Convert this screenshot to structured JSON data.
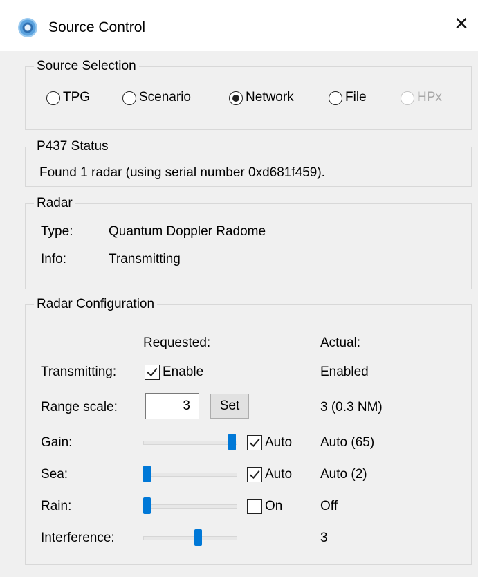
{
  "window": {
    "title": "Source Control",
    "close_glyph": "✕",
    "icon": "radar-app-icon"
  },
  "source_selection": {
    "legend": "Source Selection",
    "options": [
      {
        "label": "TPG",
        "checked": false,
        "enabled": true
      },
      {
        "label": "Scenario",
        "checked": false,
        "enabled": true
      },
      {
        "label": "Network",
        "checked": true,
        "enabled": true
      },
      {
        "label": "File",
        "checked": false,
        "enabled": true
      },
      {
        "label": "HPx",
        "checked": false,
        "enabled": false
      }
    ]
  },
  "p437_status": {
    "legend": "P437 Status",
    "message": "Found 1 radar (using serial number 0xd681f459)."
  },
  "radar": {
    "legend": "Radar",
    "type_label": "Type:",
    "type_value": "Quantum Doppler Radome",
    "info_label": "Info:",
    "info_value": "Transmitting"
  },
  "radar_config": {
    "legend": "Radar Configuration",
    "requested_header": "Requested:",
    "actual_header": "Actual:",
    "transmitting": {
      "label": "Transmitting:",
      "checkbox_label": "Enable",
      "checked": true,
      "actual": "Enabled"
    },
    "range_scale": {
      "label": "Range scale:",
      "value": "3",
      "button": "Set",
      "actual": "3 (0.3 NM)"
    },
    "gain": {
      "label": "Gain:",
      "level": 1.0,
      "checkbox_label": "Auto",
      "checked": true,
      "actual": "Auto (65)"
    },
    "sea": {
      "label": "Sea:",
      "level": 0.0,
      "checkbox_label": "Auto",
      "checked": true,
      "actual": "Auto (2)"
    },
    "rain": {
      "label": "Rain:",
      "level": 0.0,
      "checkbox_label": "On",
      "checked": false,
      "actual": "Off"
    },
    "interference": {
      "label": "Interference:",
      "level": 0.6,
      "actual": "3"
    }
  },
  "colors": {
    "accent": "#0078d7",
    "dialog_bg": "#f0f0f0",
    "group_border": "#d8d8d8",
    "disabled": "#a8a8a8"
  }
}
